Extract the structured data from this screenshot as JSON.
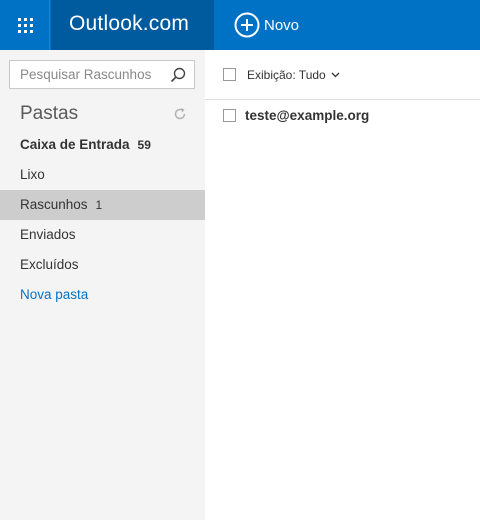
{
  "header": {
    "brand": "Outlook.com",
    "new_label": "Novo",
    "waffle_icon": "app-launcher-grid-icon",
    "new_icon": "plus-circle-icon",
    "colors": {
      "bar": "#0072c6",
      "brand_bg": "#005a9e"
    }
  },
  "sidebar": {
    "search": {
      "placeholder": "Pesquisar Rascunhos",
      "value": "",
      "icon": "search-icon"
    },
    "folders_title": "Pastas",
    "refresh_icon": "refresh-icon",
    "folders": [
      {
        "name": "Caixa de Entrada",
        "count": "59"
      },
      {
        "name": "Lixo",
        "count": ""
      },
      {
        "name": "Rascunhos",
        "count": "1"
      },
      {
        "name": "Enviados",
        "count": ""
      },
      {
        "name": "Excluídos",
        "count": ""
      },
      {
        "name": "Nova pasta",
        "count": ""
      }
    ],
    "selected_folder": "Rascunhos"
  },
  "main": {
    "view_filter": "Exibição: Tudo",
    "messages": [
      {
        "from": "teste@example.org"
      }
    ]
  }
}
